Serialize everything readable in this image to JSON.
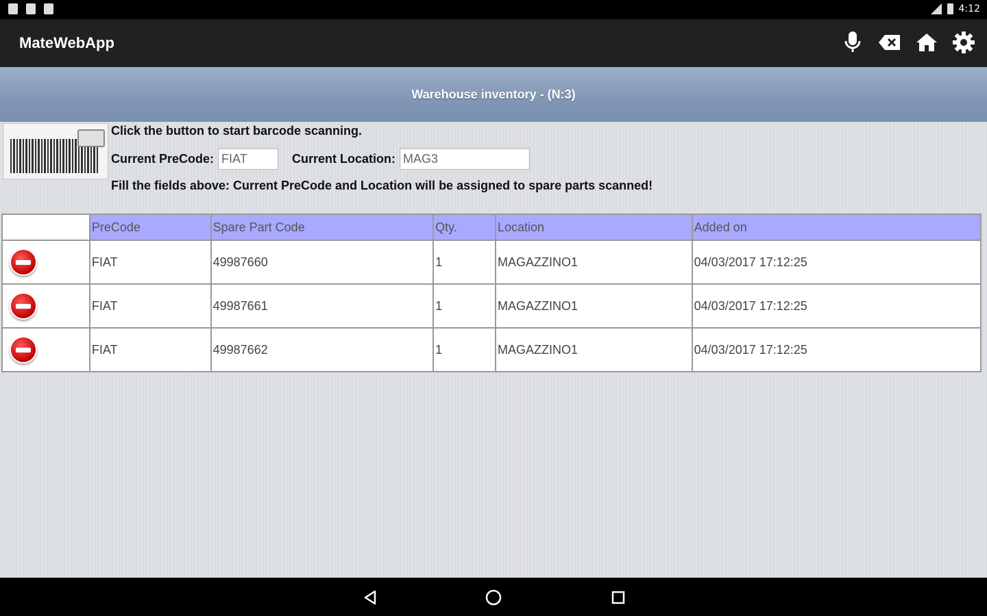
{
  "status_bar": {
    "time": "4:12",
    "left_icons": [
      "notification-icon",
      "n-icon",
      "notification-icon-2"
    ],
    "right_icons": [
      "signal-icon",
      "battery-icon"
    ]
  },
  "app_bar": {
    "title": "MateWebApp",
    "actions": [
      {
        "icon": "microphone-icon"
      },
      {
        "icon": "backspace-icon"
      },
      {
        "icon": "home-icon"
      },
      {
        "icon": "gear-icon"
      }
    ]
  },
  "header": {
    "title": "Warehouse inventory - (N:3)"
  },
  "scan": {
    "instruction": "Click the button to start barcode scanning.",
    "precode_label": "Current PreCode:",
    "precode_value": "FIAT",
    "location_label": "Current Location:",
    "location_value": "MAG3",
    "note": "Fill the fields above: Current PreCode and Location will be assigned to spare parts scanned!"
  },
  "table": {
    "columns": [
      "PreCode",
      "Spare Part Code",
      "Qty.",
      "Location",
      "Added on"
    ],
    "rows": [
      {
        "precode": "FIAT",
        "part": "49987660",
        "qty": "1",
        "location": "MAGAZZINO1",
        "added": "04/03/2017 17:12:25"
      },
      {
        "precode": "FIAT",
        "part": "49987661",
        "qty": "1",
        "location": "MAGAZZINO1",
        "added": "04/03/2017 17:12:25"
      },
      {
        "precode": "FIAT",
        "part": "49987662",
        "qty": "1",
        "location": "MAGAZZINO1",
        "added": "04/03/2017 17:12:25"
      }
    ]
  },
  "colors": {
    "app_bar": "#212121",
    "header_band": "#8196b4",
    "table_header": "#a9a9ff",
    "delete_button": "#c10000"
  }
}
